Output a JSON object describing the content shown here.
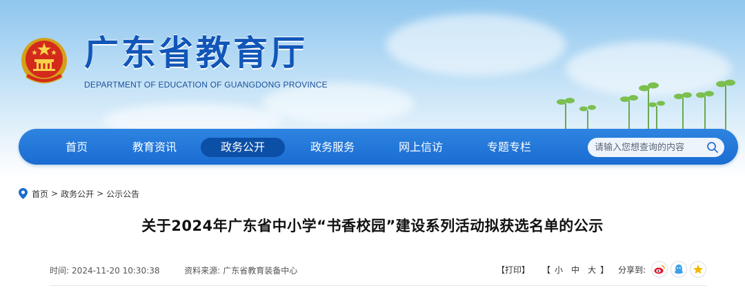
{
  "header": {
    "title": "广东省教育厅",
    "subtitle": "DEPARTMENT OF EDUCATION OF GUANGDONG PROVINCE"
  },
  "nav": {
    "items": [
      {
        "label": "首页",
        "active": false
      },
      {
        "label": "教育资讯",
        "active": false
      },
      {
        "label": "政务公开",
        "active": true
      },
      {
        "label": "政务服务",
        "active": false
      },
      {
        "label": "网上信访",
        "active": false
      },
      {
        "label": "专题专栏",
        "active": false
      }
    ],
    "search_placeholder": "请输入您想查询的内容"
  },
  "breadcrumb": [
    "首页",
    "政务公开",
    "公示公告"
  ],
  "breadcrumb_separator": ">",
  "article": {
    "title": "关于2024年广东省中小学“书香校园”建设系列活动拟获选名单的公示",
    "time_label": "时间:",
    "time_value": "2024-11-20 10:30:38",
    "source_label": "资料来源:",
    "source_value": "广东省教育装备中心"
  },
  "tools": {
    "print": "【打印】",
    "font_open": "【",
    "font_small": "小",
    "font_medium": "中",
    "font_large": "大",
    "font_close": "】",
    "share_label": "分享到:",
    "share_icons": [
      "weibo-icon",
      "qq-icon",
      "qzone-icon"
    ]
  },
  "colors": {
    "brand_blue": "#1156b8",
    "nav_blue": "#1a6cd2",
    "nav_active": "#0c4fa6"
  }
}
